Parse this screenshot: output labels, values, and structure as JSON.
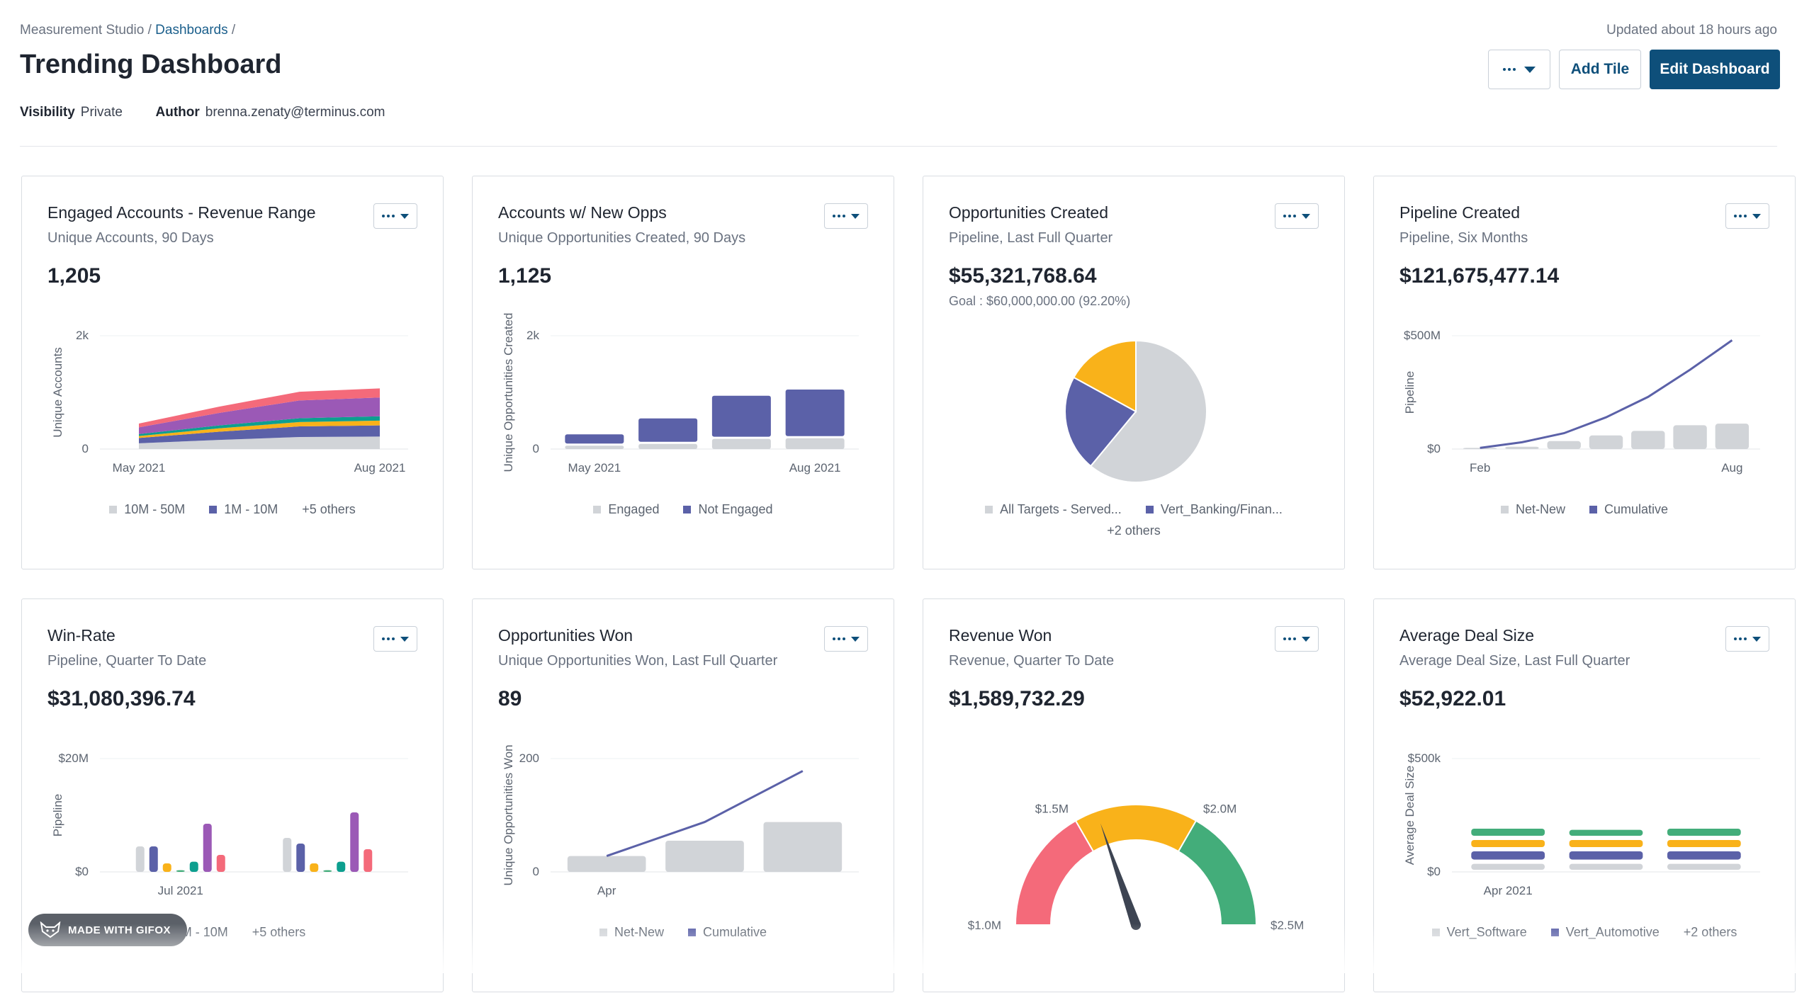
{
  "breadcrumb": {
    "root": "Measurement Studio /",
    "current": "Dashboards",
    "sep": " /"
  },
  "updated": "Updated about 18 hours ago",
  "title": "Trending Dashboard",
  "meta": {
    "visibility_label": "Visibility",
    "visibility_value": "Private",
    "author_label": "Author",
    "author_value": "brenna.zenaty@terminus.com"
  },
  "actions": {
    "more_icon": "ellipsis-icon",
    "add_tile": "Add Tile",
    "edit_dashboard": "Edit Dashboard"
  },
  "colors": {
    "primary": "#0e4f7a",
    "purple": "#5b61a8",
    "gray": "#d1d4d8",
    "red": "#f46a7a",
    "yellow": "#f9b21a",
    "green": "#43ad7a",
    "teal": "#0d9f8f",
    "violet": "#9b59b6"
  },
  "tiles": [
    {
      "title": "Engaged Accounts - Revenue Range",
      "subtitle": "Unique Accounts, 90 Days",
      "value": "1,205",
      "legend": [
        "10M - 50M",
        "1M - 10M",
        "+5 others"
      ]
    },
    {
      "title": "Accounts w/ New Opps",
      "subtitle": "Unique Opportunities Created, 90 Days",
      "value": "1,125",
      "legend": [
        "Engaged",
        "Not Engaged"
      ]
    },
    {
      "title": "Opportunities Created",
      "subtitle": "Pipeline, Last Full Quarter",
      "value": "$55,321,768.64",
      "goal": "Goal : $60,000,000.00 (92.20%)",
      "legend": [
        "All Targets - Served...",
        "Vert_Banking/Finan..."
      ],
      "legend_more": "+2 others"
    },
    {
      "title": "Pipeline Created",
      "subtitle": "Pipeline, Six Months",
      "value": "$121,675,477.14",
      "legend": [
        "Net-New",
        "Cumulative"
      ]
    },
    {
      "title": "Win-Rate",
      "subtitle": "Pipeline, Quarter To Date",
      "value": "$31,080,396.74",
      "legend": [
        "1M - 10M",
        "+5 others"
      ]
    },
    {
      "title": "Opportunities Won",
      "subtitle": "Unique Opportunities Won, Last Full Quarter",
      "value": "89",
      "legend": [
        "Net-New",
        "Cumulative"
      ]
    },
    {
      "title": "Revenue Won",
      "subtitle": "Revenue, Quarter To Date",
      "value": "$1,589,732.29",
      "legend": []
    },
    {
      "title": "Average Deal Size",
      "subtitle": "Average Deal Size, Last Full Quarter",
      "value": "$52,922.01",
      "legend": [
        "Vert_Software",
        "Vert_Automotive",
        "+2 others"
      ]
    }
  ],
  "chart_data": [
    {
      "type": "area",
      "title": "Engaged Accounts - Revenue Range",
      "ylabel": "Unique Accounts",
      "x_ticks": [
        "May 2021",
        "Aug 2021"
      ],
      "y_ticks": [
        "2k",
        "0"
      ],
      "ylim": [
        0,
        2000
      ],
      "x": [
        0,
        1,
        2,
        3
      ],
      "series": [
        {
          "name": "10M - 50M",
          "color": "#d1d4d8",
          "values": [
            120,
            190,
            250,
            260
          ]
        },
        {
          "name": "1M - 10M",
          "color": "#5b61a8",
          "values": [
            110,
            170,
            220,
            230
          ]
        },
        {
          "color": "#f9b21a",
          "values": [
            40,
            70,
            90,
            100
          ]
        },
        {
          "color": "#0d9f8f",
          "values": [
            40,
            60,
            80,
            90
          ]
        },
        {
          "color": "#9b59b6",
          "values": [
            140,
            260,
            370,
            390
          ]
        },
        {
          "color": "#f46a7a",
          "values": [
            80,
            130,
            180,
            190
          ]
        }
      ]
    },
    {
      "type": "bar",
      "title": "Accounts w/ New Opps",
      "ylabel": "Unique Opportunities Created",
      "categories": [
        "May 2021",
        "",
        "",
        "Aug 2021"
      ],
      "y_ticks": [
        "2k",
        "0"
      ],
      "ylim": [
        0,
        2000
      ],
      "series": [
        {
          "name": "Engaged",
          "color": "#d1d4d8",
          "values": [
            60,
            90,
            180,
            190
          ]
        },
        {
          "name": "Not Engaged",
          "color": "#5b61a8",
          "values": [
            200,
            450,
            760,
            860
          ]
        }
      ]
    },
    {
      "type": "pie",
      "title": "Opportunities Created",
      "slices": [
        {
          "name": "All Targets - Served...",
          "color": "#d1d4d8",
          "value": 0.61
        },
        {
          "name": "Vert_Banking/Finan...",
          "color": "#5b61a8",
          "value": 0.22
        },
        {
          "color": "#f9b21a",
          "value": 0.17
        }
      ]
    },
    {
      "type": "bar",
      "title": "Pipeline Created",
      "ylabel": "Pipeline",
      "categories": [
        "Feb",
        "",
        "",
        "",
        "",
        "",
        "Aug"
      ],
      "y_ticks": [
        "$500M",
        "$0"
      ],
      "ylim": [
        0,
        500
      ],
      "series": [
        {
          "name": "Net-New",
          "color": "#d1d4d8",
          "values": [
            5,
            10,
            35,
            60,
            80,
            105,
            112
          ]
        },
        {
          "name": "Cumulative",
          "color": "#5b61a8",
          "type": "line",
          "values": [
            5,
            30,
            70,
            140,
            230,
            350,
            480
          ]
        }
      ]
    },
    {
      "type": "bar",
      "title": "Win-Rate",
      "ylabel": "Pipeline",
      "categories": [
        "Jul 2021",
        ""
      ],
      "y_ticks": [
        "$20M",
        "$0"
      ],
      "ylim": [
        0,
        20
      ],
      "series": [
        {
          "color": "#d1d4d8",
          "values": [
            4.5,
            6
          ]
        },
        {
          "name": "1M - 10M",
          "color": "#5b61a8",
          "values": [
            4.5,
            5
          ]
        },
        {
          "color": "#f9b21a",
          "values": [
            1.5,
            1.5
          ]
        },
        {
          "color": "#43ad7a",
          "values": [
            0.3,
            0.3
          ]
        },
        {
          "color": "#0d9f8f",
          "values": [
            1.8,
            1.8
          ]
        },
        {
          "color": "#9b59b6",
          "values": [
            8.5,
            10.5
          ]
        },
        {
          "color": "#f46a7a",
          "values": [
            3,
            4
          ]
        }
      ]
    },
    {
      "type": "bar",
      "title": "Opportunities Won",
      "ylabel": "Unique Opportunities Won",
      "categories": [
        "Apr",
        "",
        ""
      ],
      "y_ticks": [
        "200",
        "0"
      ],
      "ylim": [
        0,
        200
      ],
      "series": [
        {
          "name": "Net-New",
          "color": "#d1d4d8",
          "values": [
            28,
            55,
            88
          ]
        },
        {
          "name": "Cumulative",
          "color": "#5b61a8",
          "type": "line",
          "values": [
            28,
            88,
            178
          ]
        }
      ]
    },
    {
      "type": "gauge",
      "title": "Revenue Won",
      "labels": [
        "$1.0M",
        "$1.5M",
        "$2.0M",
        "$2.5M"
      ],
      "min": 1.0,
      "max": 2.5,
      "value": 1.59,
      "bands": [
        {
          "color": "#f46a7a",
          "from": 1.0,
          "to": 1.5
        },
        {
          "color": "#f9b21a",
          "from": 1.5,
          "to": 2.0
        },
        {
          "color": "#43ad7a",
          "from": 2.0,
          "to": 2.5
        }
      ]
    },
    {
      "type": "bar",
      "title": "Average Deal Size",
      "ylabel": "Average Deal Size",
      "categories": [
        "Apr 2021",
        "",
        ""
      ],
      "y_ticks": [
        "$500k",
        "$0"
      ],
      "ylim": [
        0,
        500
      ],
      "stacked": true,
      "series": [
        {
          "name": "Vert_Software",
          "color": "#d1d4d8",
          "values": [
            45,
            45,
            45
          ]
        },
        {
          "name": "Vert_Automotive",
          "color": "#5b61a8",
          "values": [
            55,
            55,
            55
          ]
        },
        {
          "color": "#f9b21a",
          "values": [
            50,
            50,
            50
          ]
        },
        {
          "color": "#43ad7a",
          "values": [
            50,
            45,
            50
          ]
        }
      ]
    }
  ],
  "watermark": "MADE WITH GIFOX"
}
